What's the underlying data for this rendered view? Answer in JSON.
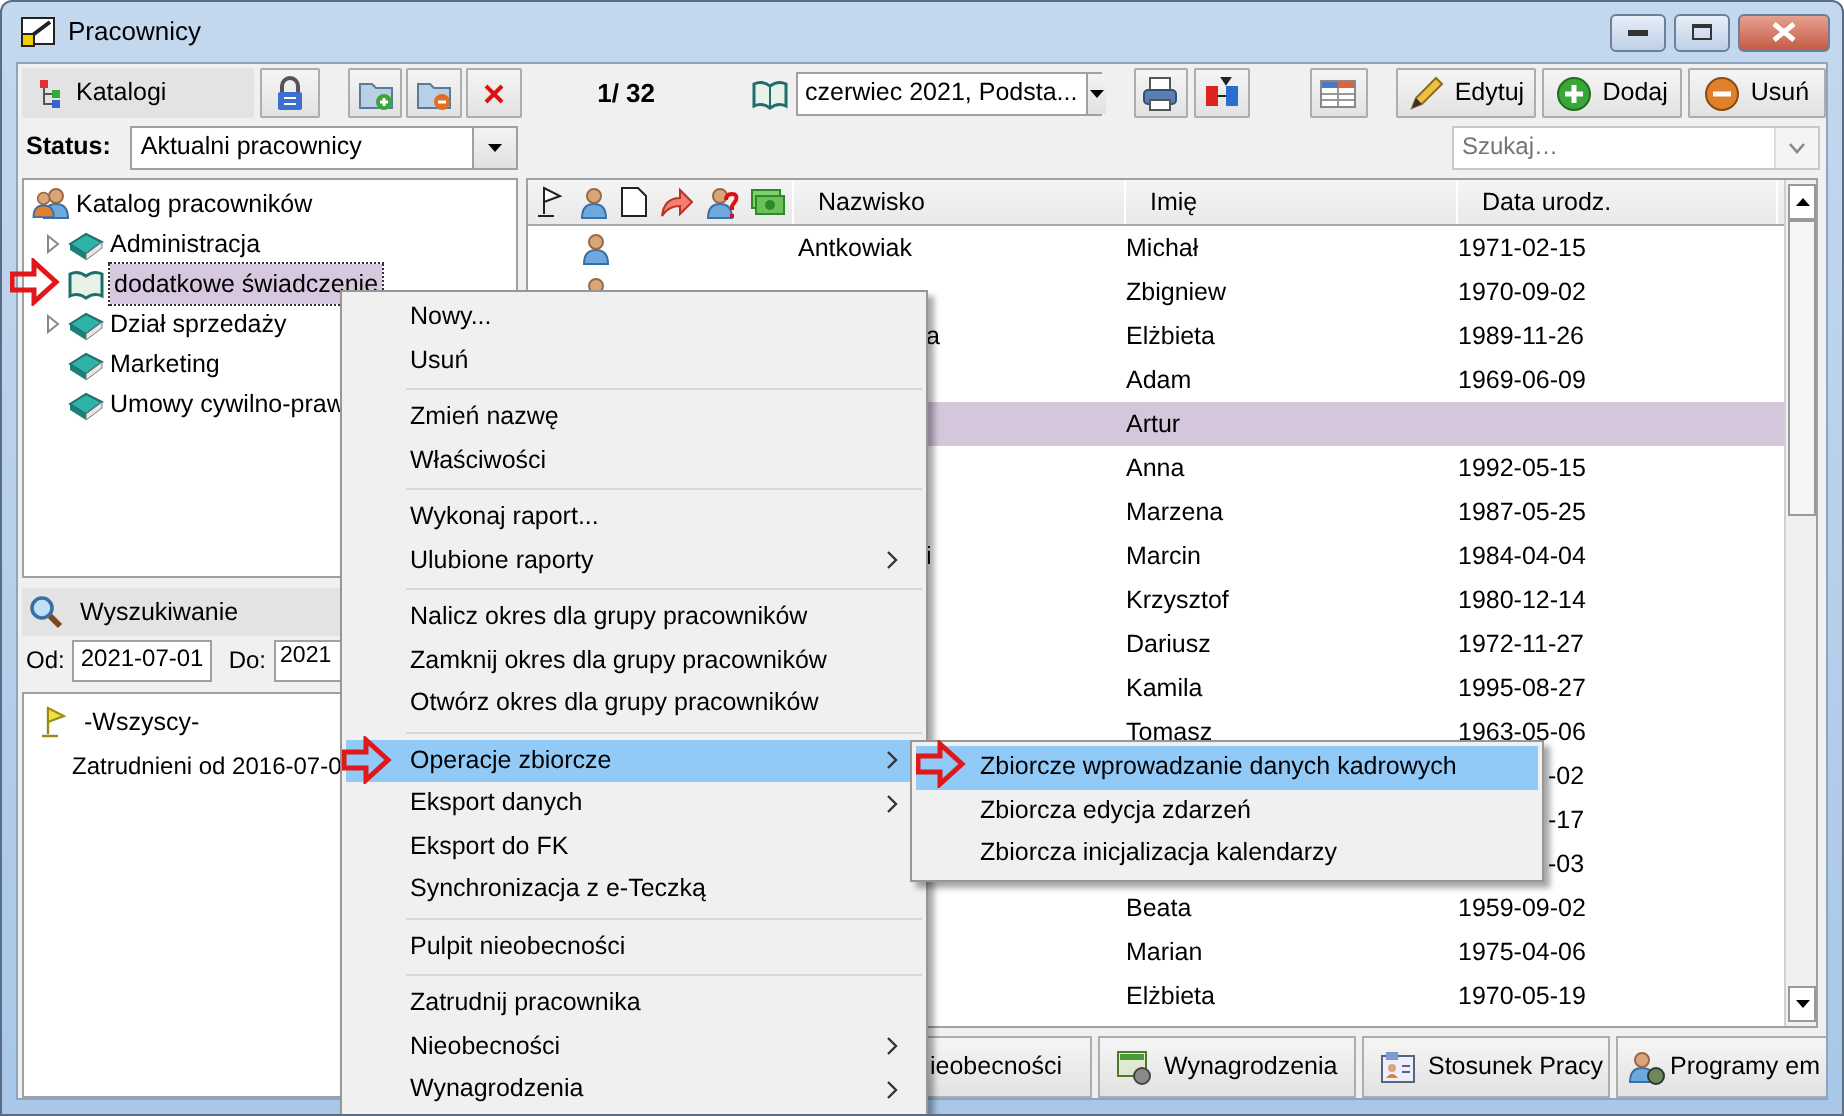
{
  "window": {
    "title": "Pracownicy"
  },
  "toolbar": {
    "catalog_button": "Katalogi",
    "counter": "1/ 32",
    "period": "czerwiec 2021, Podsta...",
    "buttons": [
      {
        "label": "Edytuj",
        "kind": "edit"
      },
      {
        "label": "Dodaj",
        "kind": "add"
      },
      {
        "label": "Usuń",
        "kind": "remove"
      }
    ]
  },
  "status": {
    "label": "Status:",
    "value": "Aktualni pracownicy"
  },
  "search": {
    "placeholder": "Szukaj…"
  },
  "tree": {
    "root": "Katalog pracowników",
    "children": [
      {
        "label": "Administracja",
        "expandable": true,
        "selected": false
      },
      {
        "label": "dodatkowe świadczenie",
        "expandable": false,
        "selected": true
      },
      {
        "label": "Dział sprzedaży",
        "expandable": true,
        "selected": false
      },
      {
        "label": "Marketing",
        "expandable": false,
        "selected": false
      },
      {
        "label": "Umowy cywilno-praw",
        "expandable": false,
        "selected": false
      }
    ]
  },
  "finder": {
    "title": "Wyszukiwanie",
    "from_label": "Od:",
    "from": "2021-07-01",
    "to_label": "Do:",
    "to": "2021",
    "items": [
      {
        "label": "-Wszyscy-",
        "kind": "flag"
      },
      {
        "label": "Zatrudnieni od 2016-07-0",
        "kind": "plain"
      }
    ]
  },
  "grid": {
    "columns": [
      "Nazwisko",
      "Imię",
      "Data urodz."
    ],
    "rows": [
      {
        "employee_icon": true,
        "surname": "Antkowiak",
        "first_name": "Michał",
        "birth_date": "1971-02-15",
        "selected": false
      },
      {
        "employee_icon": true,
        "first_name": "Zbigniew",
        "birth_date": "1970-09-02",
        "selected": false
      },
      {
        "surname_tail": "a",
        "first_name": "Elżbieta",
        "birth_date": "1989-11-26",
        "selected": false
      },
      {
        "first_name": "Adam",
        "birth_date": "1969-06-09",
        "selected": false
      },
      {
        "first_name": "Artur",
        "selected": true
      },
      {
        "first_name": "Anna",
        "birth_date": "1992-05-15",
        "selected": false
      },
      {
        "first_name": "Marzena",
        "birth_date": "1987-05-25",
        "selected": false
      },
      {
        "surname_tail": "i",
        "first_name": "Marcin",
        "birth_date": "1984-04-04",
        "selected": false
      },
      {
        "first_name": "Krzysztof",
        "birth_date": "1980-12-14",
        "selected": false
      },
      {
        "first_name": "Dariusz",
        "birth_date": "1972-11-27",
        "selected": false
      },
      {
        "first_name": "Kamila",
        "birth_date": "1995-08-27",
        "selected": false
      },
      {
        "first_name": "Tomasz",
        "birth_date": "1963-05-06",
        "selected": false
      },
      {
        "birth_date_tail": "-02",
        "selected": false
      },
      {
        "birth_date_tail": "-17",
        "selected": false
      },
      {
        "birth_date_tail": "-03",
        "selected": false
      },
      {
        "first_name": "Beata",
        "birth_date": "1959-09-02",
        "selected": false
      },
      {
        "first_name": "Marian",
        "birth_date": "1975-04-06",
        "selected": false
      },
      {
        "first_name": "Elżbieta",
        "birth_date": "1970-05-19",
        "selected": false
      }
    ]
  },
  "bottom_tabs": [
    {
      "label": "ieobecności",
      "kind": "absence"
    },
    {
      "label": "Wynagrodzenia",
      "kind": "salary"
    },
    {
      "label": "Stosunek Pracy",
      "kind": "contract"
    },
    {
      "label": "Programy em",
      "kind": "programs"
    }
  ],
  "context_menu": [
    {
      "kind": "item",
      "label": "Nowy...",
      "submenu": false,
      "selected": false
    },
    {
      "kind": "item",
      "label": "Usuń",
      "submenu": false,
      "selected": false
    },
    {
      "kind": "separator"
    },
    {
      "kind": "item",
      "label": "Zmień nazwę",
      "submenu": false,
      "selected": false
    },
    {
      "kind": "item",
      "label": "Właściwości",
      "submenu": false,
      "selected": false
    },
    {
      "kind": "separator"
    },
    {
      "kind": "item",
      "label": "Wykonaj raport...",
      "submenu": false,
      "selected": false
    },
    {
      "kind": "item",
      "label": "Ulubione raporty",
      "submenu": true,
      "selected": false
    },
    {
      "kind": "separator"
    },
    {
      "kind": "item",
      "label": "Nalicz okres dla grupy pracowników",
      "submenu": false,
      "selected": false
    },
    {
      "kind": "item",
      "label": "Zamknij okres dla grupy pracowników",
      "submenu": false,
      "selected": false
    },
    {
      "kind": "item",
      "label": "Otwórz okres dla grupy pracowników",
      "submenu": false,
      "selected": false
    },
    {
      "kind": "separator"
    },
    {
      "kind": "item",
      "label": "Operacje zbiorcze",
      "submenu": true,
      "selected": true
    },
    {
      "kind": "item",
      "label": "Eksport danych",
      "submenu": true,
      "selected": false
    },
    {
      "kind": "item",
      "label": "Eksport do FK",
      "submenu": false,
      "selected": false
    },
    {
      "kind": "item",
      "label": "Synchronizacja z e-Teczką",
      "submenu": false,
      "selected": false
    },
    {
      "kind": "separator"
    },
    {
      "kind": "item",
      "label": "Pulpit nieobecności",
      "submenu": false,
      "selected": false
    },
    {
      "kind": "separator"
    },
    {
      "kind": "item",
      "label": "Zatrudnij pracownika",
      "submenu": false,
      "selected": false
    },
    {
      "kind": "item",
      "label": "Nieobecności",
      "submenu": true,
      "selected": false
    },
    {
      "kind": "item",
      "label": "Wynagrodzenia",
      "submenu": true,
      "selected": false
    }
  ],
  "submenu": [
    {
      "label": "Zbiorcze wprowadzanie danych kadrowych",
      "selected": true
    },
    {
      "label": "Zbiorcza edycja zdarzeń",
      "selected": false
    },
    {
      "label": "Zbiorcza inicjalizacja kalendarzy",
      "selected": false
    }
  ]
}
